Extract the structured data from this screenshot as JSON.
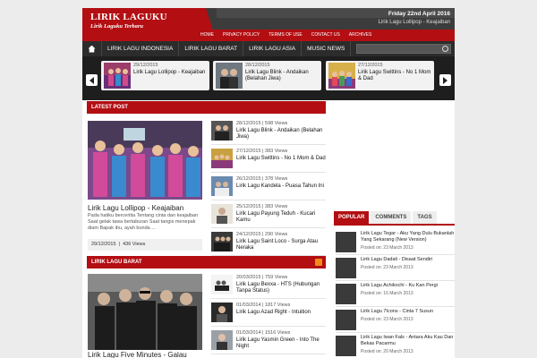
{
  "header": {
    "site_title": "LIRIK LAGUKU",
    "tagline": "Lirik Laguku Terbaru",
    "date": "Friday 22nd April 2016",
    "featured_post": "Lirik Lagu Lollipop - Keajaiban",
    "top_nav": [
      "HOME",
      "PRIVACY POLICY",
      "TERMS OF USE",
      "CONTACT US",
      "ARCHIVES"
    ]
  },
  "main_nav": [
    "LIRIK LAGU INDONESIA",
    "LIRIK LAGU BARAT",
    "LIRIK LAGU ASIA",
    "MUSIC NEWS"
  ],
  "search": {
    "placeholder": ""
  },
  "ticker": [
    {
      "date": "29/12/2015",
      "title": "Lirik Lagu Lollipop - Keajaiban"
    },
    {
      "date": "28/12/2015",
      "title": "Lirik Lagu Blink - Andaikan (Belahan Jiwa)"
    },
    {
      "date": "27/12/2015",
      "title": "Lirik Lagu Swittins - No 1 Mom & Dad"
    }
  ],
  "latest": {
    "heading": "LATEST POST",
    "featured": {
      "title": "Lirik Lagu Lollipop - Keajaiban",
      "excerpt": "Pada hatiku berceritia Tentang cinta dan keajaiban Saat gelak tawa bertaburan Saat tangis menepak diam Bapak ibu, ayah bunda ...",
      "date": "29/12/2015",
      "views": "436 Views"
    },
    "items": [
      {
        "date": "28/12/2015",
        "views": "598 Views",
        "title": "Lirik Lagu Blink - Andaikan (Belahan Jiwa)"
      },
      {
        "date": "27/12/2015",
        "views": "383 Views",
        "title": "Lirik Lagu Swittins - No 1 Mom & Dad"
      },
      {
        "date": "26/12/2015",
        "views": "378 Views",
        "title": "Lirik Lagu Kandela - Puasa Tahun Ini"
      },
      {
        "date": "25/12/2015",
        "views": "383 Views",
        "title": "Lirik Lagu Payung Teduh - Kucari Kamu"
      },
      {
        "date": "24/12/2015",
        "views": "290 Views",
        "title": "Lirik Lagu Saint Loco - Surga Atau Neraka"
      }
    ]
  },
  "barat": {
    "heading": "LIRIK LAGU BARAT",
    "featured_title": "Lirik Lagu Five Minutes - Galau",
    "items": [
      {
        "date": "20/03/2015",
        "views": "759 Views",
        "title": "Lirik Lagu Bexxa - HTS (Hubungan Tanpa Status)"
      },
      {
        "date": "01/03/2014",
        "views": "1817 Views",
        "title": "Lirik Lagu Azad Right - Intuition"
      },
      {
        "date": "01/03/2014",
        "views": "1516 Views",
        "title": "Lirik Lagu Yasmin Green - Into The Night"
      }
    ]
  },
  "sidebar": {
    "tabs": [
      "POPULAR",
      "COMMENTS",
      "TAGS"
    ],
    "popular": [
      {
        "title": "Lirik Lagu Tegar - Aku Yang Dulu Bukanlah Yang Sekarang (New Version)",
        "date": "Posted on: 23 March 2013"
      },
      {
        "title": "Lirik Lagu Dadali - Disaat Sendiri",
        "date": "Posted on: 23 March 2013"
      },
      {
        "title": "Lirik Lagu Achikochi - Ku Kan Pergi",
        "date": "Posted on: 16 March 2013"
      },
      {
        "title": "Lirik Lagu 7Icons - Cinta 7 Susun",
        "date": "Posted on: 23 March 2013"
      },
      {
        "title": "Lirik Lagu Iwan Fals - Antara Aku Kau Dan Bekas Pacarmu",
        "date": "Posted on: 20 March 2013"
      }
    ]
  }
}
